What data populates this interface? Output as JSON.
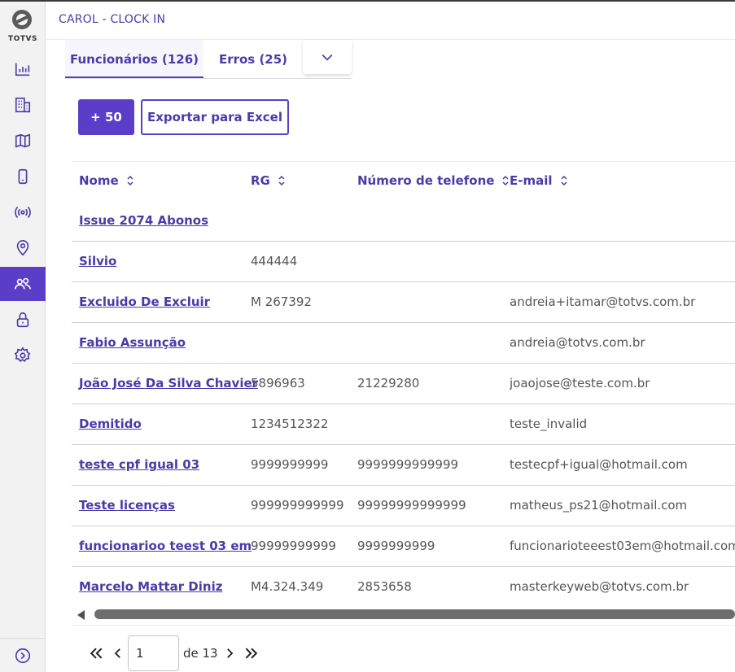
{
  "app": {
    "brand": "TOTVS",
    "title": "CAROL - CLOCK IN",
    "accent_color": "#5b3ec8"
  },
  "sidebar": {
    "items": [
      {
        "icon": "bar-chart-icon",
        "active": false
      },
      {
        "icon": "building-icon",
        "active": false
      },
      {
        "icon": "map-icon",
        "active": false
      },
      {
        "icon": "mobile-icon",
        "active": false
      },
      {
        "icon": "broadcast-icon",
        "active": false
      },
      {
        "icon": "location-pin-icon",
        "active": false
      },
      {
        "icon": "users-icon",
        "active": true
      },
      {
        "icon": "lock-icon",
        "active": false
      },
      {
        "icon": "gear-icon",
        "active": false
      }
    ],
    "expand_icon": "chevron-right-circle-icon"
  },
  "tabs": [
    {
      "label": "Funcionários (126)",
      "active": true
    },
    {
      "label": "Erros (25)",
      "active": false
    }
  ],
  "toolbar": {
    "add_label": "+ 50",
    "export_label": "Exportar para Excel"
  },
  "table": {
    "columns": [
      "Nome",
      "RG",
      "Número de telefone",
      "E-mail"
    ],
    "rows": [
      {
        "nome": "Issue 2074 Abonos",
        "rg": "",
        "telefone": "",
        "email": ""
      },
      {
        "nome": "Silvio",
        "rg": "444444",
        "telefone": "",
        "email": ""
      },
      {
        "nome": "Excluido De Excluir",
        "rg": "M 267392",
        "telefone": "",
        "email": "andreia+itamar@totvs.com.br"
      },
      {
        "nome": "Fabio Assunção",
        "rg": "",
        "telefone": "",
        "email": "andreia@totvs.com.br"
      },
      {
        "nome": "João José Da Silva Chavier",
        "rg": "5896963",
        "telefone": "21229280",
        "email": "joaojose@teste.com.br"
      },
      {
        "nome": "Demitido",
        "rg": "1234512322",
        "telefone": "",
        "email": "teste_invalid"
      },
      {
        "nome": "teste cpf igual 03",
        "rg": "9999999999",
        "telefone": "9999999999999",
        "email": "testecpf+igual@hotmail.com"
      },
      {
        "nome": "Teste licenças",
        "rg": "999999999999",
        "telefone": "99999999999999",
        "email": "matheus_ps21@hotmail.com"
      },
      {
        "nome": "funcionarioo teest 03 em",
        "rg": "99999999999",
        "telefone": "9999999999",
        "email": "funcionarioteeest03em@hotmail.com"
      },
      {
        "nome": "Marcelo Mattar Diniz",
        "rg": "M4.324.349",
        "telefone": "2853658",
        "email": "masterkeyweb@totvs.com.br"
      }
    ]
  },
  "pagination": {
    "current_page": "1",
    "of_label": "de 13"
  }
}
